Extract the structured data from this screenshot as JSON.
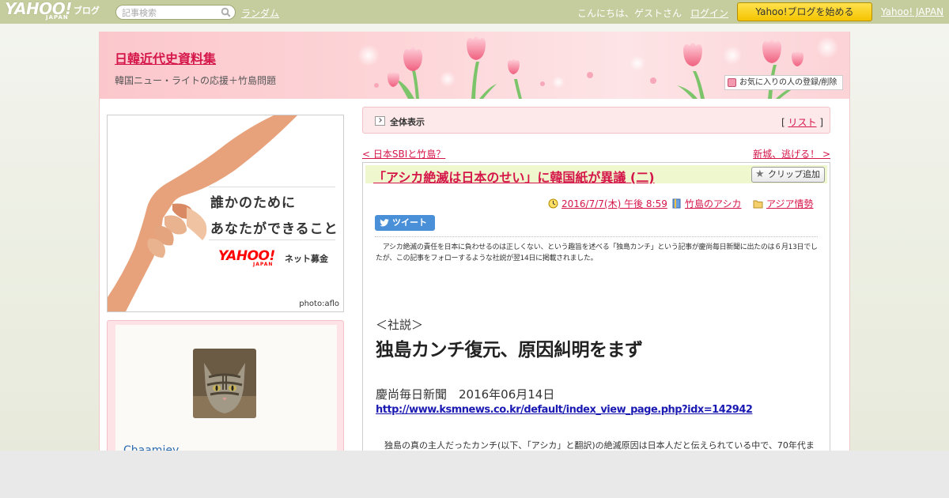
{
  "topbar": {
    "logo_text": "YAHOO!",
    "logo_sub": "JAPAN",
    "logo_blog": "ブログ",
    "search_placeholder": "記事検索",
    "random_link": "ランダム",
    "greeting": "こんにちは、ゲストさん",
    "login_link": "ログイン",
    "start_button": "Yahoo!ブログを始める",
    "yahoo_japan_link": "Yahoo! JAPAN"
  },
  "header": {
    "blog_title": "日韓近代史資料集",
    "blog_description": "韓国ニュー・ライトの応援＋竹島問題",
    "favorite_button": "お気に入りの人の登録/削除"
  },
  "ad": {
    "line1": "誰かのために",
    "line2": "あなたができること",
    "brand": "YAHOO!",
    "brand_sub": "JAPAN",
    "service": "ネット募金",
    "credit": "photo:aflo"
  },
  "profile": {
    "username": "Chaamiey"
  },
  "list_bar": {
    "label": "全体表示",
    "list_prefix": "[ ",
    "list_link": "リスト",
    "list_suffix": " ]"
  },
  "pager": {
    "prev": "< 日本SBIと竹島？",
    "next": "新城、逃げる！ >"
  },
  "article": {
    "title": "「アシカ絶滅は日本のせい」に韓国紙が異議 (二)",
    "clip_button": "クリップ追加",
    "datetime": "2016/7/7(木) 午後 8:59",
    "category": "竹島のアシカ",
    "folder": "アジア情勢",
    "tweet_button": "ツイート",
    "lead": "　アシカ絶滅の責任を日本に負わせるのは正しくない、という趣旨を述べる「独島カンチ」という記事が慶尚毎日新聞に出たのは６月13日でしたが、この記事をフォローするような社説が翌14日に掲載されました。",
    "editorial_label": "＜社説＞",
    "headline": "独島カンチ復元、原因糾明をまず",
    "source": "慶尚毎日新聞　2016年06月14日",
    "url": "http://www.ksmnews.co.kr/default/index_view_page.php?idx=142942",
    "body": "　独島の真の主人だったカンチ(以下、「アシカ」と翻訳)の絶滅原因は日本人だと伝えられている中で、70年代ま"
  },
  "colors": {
    "accent": "#d5164a",
    "topbar": "#c5cd9f",
    "start_button": "#ffd400",
    "header_pink": "#fbc7cc",
    "link_blue": "#1a1ab3"
  }
}
